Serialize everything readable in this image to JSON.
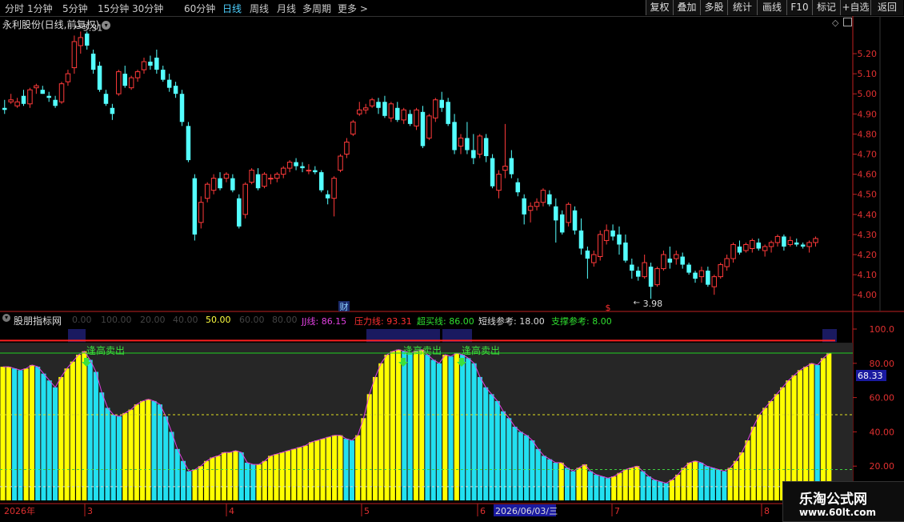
{
  "toolbar": {
    "timeframes": [
      {
        "label": "分时",
        "active": false
      },
      {
        "label": "1分钟",
        "active": false
      },
      {
        "label": "5分钟",
        "active": false
      },
      {
        "label": "15分钟",
        "active": false
      },
      {
        "label": "30分钟",
        "active": false
      },
      {
        "label": "60分钟",
        "active": false
      },
      {
        "label": "日线",
        "active": true
      },
      {
        "label": "周线",
        "active": false
      },
      {
        "label": "月线",
        "active": false
      },
      {
        "label": "多周期",
        "active": false
      },
      {
        "label": "更多 >",
        "active": false
      }
    ],
    "right_buttons": [
      "复权",
      "叠加",
      "多股",
      "统计",
      "画线",
      "F10",
      "标记",
      "+自选",
      "返回"
    ]
  },
  "stock": {
    "title": "永利股份(日线,前复权)",
    "high_marker": "5.31",
    "low_marker": "3.98",
    "event_cai": "财",
    "event_s": "$"
  },
  "price_axis": [
    "5.20",
    "5.10",
    "5.00",
    "4.90",
    "4.80",
    "4.70",
    "4.60",
    "4.50",
    "4.40",
    "4.30",
    "4.20",
    "4.10",
    "4.00"
  ],
  "indicator": {
    "name": "股朋指标网",
    "scale_items": [
      "0.00",
      "100.00",
      "20.00",
      "40.00"
    ],
    "mid_value": "50.00",
    "scale_items2": [
      "60.00",
      "80.00"
    ],
    "jj": "JJ线: 86.15",
    "pressure": "压力线: 93.31",
    "overbought": "超买线: 86.00",
    "short_ref": "短线参考: 18.00",
    "support_ref": "支撑参考: 8.00",
    "signal_text": "逢高卖出",
    "current_value": "68.33",
    "axis": [
      "100.0",
      "80.00",
      "60.00",
      "40.00",
      "20.00"
    ]
  },
  "dates": {
    "year": "2026年",
    "months": [
      "3",
      "4",
      "5",
      "6",
      "7",
      "8"
    ],
    "cursor_date": "2026/06/03/三"
  },
  "watermark": {
    "name": "乐淘公式网",
    "url": "www.60lt.com"
  },
  "colors": {
    "up": "#ff3a3a",
    "down": "#54ffff",
    "yellow": "#ffff00",
    "cyan": "#22e0f0",
    "pressure_line": "#ff2020",
    "overbought_line": "#20d020",
    "signal_green": "#3ce03c"
  }
}
